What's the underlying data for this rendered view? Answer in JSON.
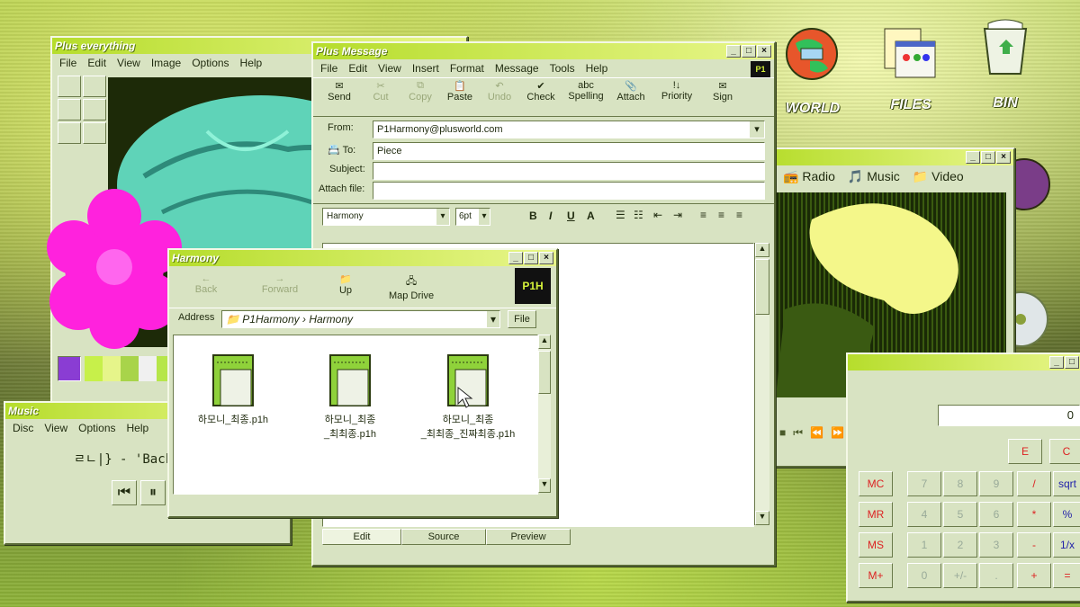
{
  "desktop": {
    "icons": [
      {
        "label": "WORLD"
      },
      {
        "label": "FILES"
      },
      {
        "label": "BIN"
      }
    ]
  },
  "paint": {
    "title": "Plus everything",
    "menu": [
      "File",
      "Edit",
      "View",
      "Image",
      "Options",
      "Help"
    ]
  },
  "message": {
    "title": "Plus Message",
    "menu": [
      "File",
      "Edit",
      "View",
      "Insert",
      "Format",
      "Message",
      "Tools",
      "Help"
    ],
    "toolbar": [
      "Send",
      "Cut",
      "Copy",
      "Paste",
      "Undo",
      "Check",
      "Spelling",
      "Attach",
      "Priority",
      "Sign"
    ],
    "from_label": "From:",
    "from_value": "P1Harmony@plusworld.com",
    "to_label": "To:",
    "to_value": "Piece",
    "subject_label": "Subject:",
    "attach_label": "Attach file:",
    "font_value": "Harmony",
    "size_value": "6pt",
    "tabs": [
      "Edit",
      "Source",
      "Preview"
    ]
  },
  "explorer": {
    "title": "Harmony",
    "toolbar": [
      "Back",
      "Forward",
      "Up",
      "Map Drive"
    ],
    "address_label": "Address",
    "address_path": "P1Harmony",
    "address_sep": "›",
    "address_folder": "Harmony",
    "file_button": "File",
    "files": [
      {
        "name_line1": "하모니_최종.p1h",
        "name_line2": ""
      },
      {
        "name_line1": "하모니_최종",
        "name_line2": "_최최종.p1h"
      },
      {
        "name_line1": "하모니_최종",
        "name_line2": "_최최종_진짜최종.p1h"
      }
    ]
  },
  "media": {
    "tabs": [
      "Radio",
      "Music",
      "Video"
    ]
  },
  "music": {
    "title": "Music",
    "menu": [
      "Disc",
      "View",
      "Options",
      "Help"
    ],
    "track": "ㄹㄴ|} - 'Back Do"
  },
  "calculator": {
    "mem_buttons": [
      "MC",
      "MR",
      "MS",
      "M+"
    ],
    "top_buttons": [
      "E",
      "C"
    ],
    "rows": [
      [
        "7",
        "8",
        "9",
        "/",
        "sqrt"
      ],
      [
        "4",
        "5",
        "6",
        "*",
        "%"
      ],
      [
        "1",
        "2",
        "3",
        "-",
        "1/x"
      ],
      [
        "0",
        "+/-",
        ".",
        "+",
        "="
      ]
    ],
    "display": "0"
  }
}
